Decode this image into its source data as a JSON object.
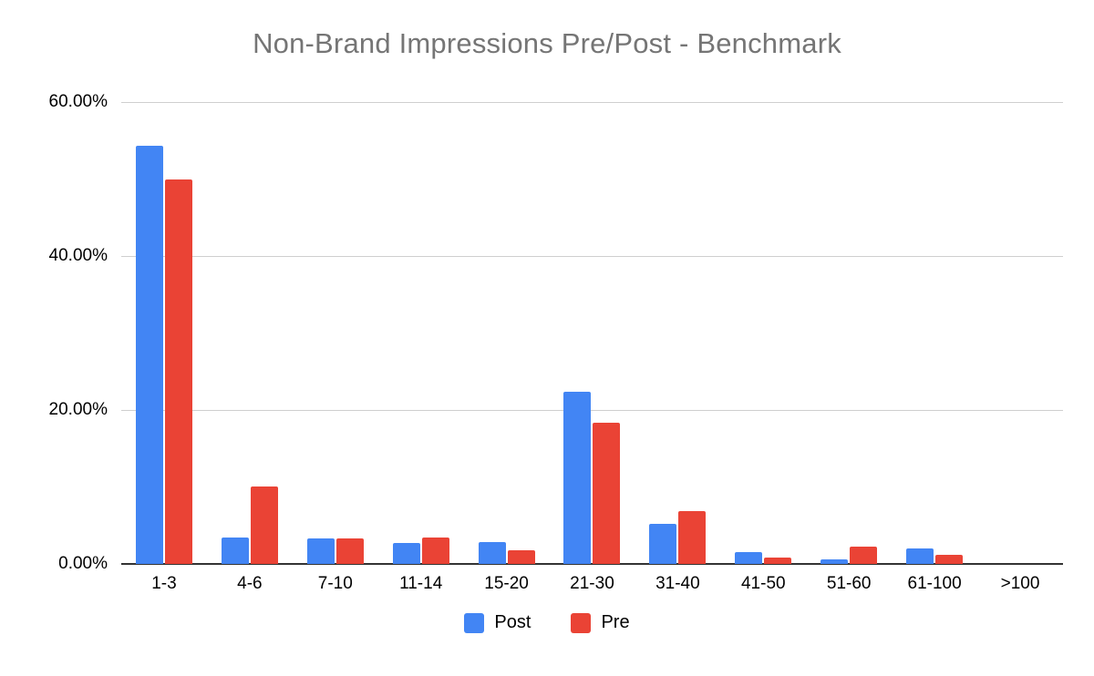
{
  "chart_data": {
    "type": "bar",
    "title": "Non-Brand Impressions Pre/Post - Benchmark",
    "xlabel": "",
    "ylabel": "",
    "categories": [
      "1-3",
      "4-6",
      "7-10",
      "11-14",
      "15-20",
      "21-30",
      "31-40",
      "41-50",
      "51-60",
      "61-100",
      ">100"
    ],
    "series": [
      {
        "name": "Post",
        "color": "#4285f4",
        "values": [
          54.3,
          3.4,
          3.3,
          2.7,
          2.8,
          22.4,
          5.2,
          1.5,
          0.6,
          2.0,
          0.0
        ]
      },
      {
        "name": "Pre",
        "color": "#ea4335",
        "values": [
          50.0,
          10.1,
          3.3,
          3.4,
          1.8,
          18.3,
          6.9,
          0.8,
          2.2,
          1.2,
          0.0
        ]
      }
    ],
    "ylim": [
      0,
      60
    ],
    "y_ticks": [
      60,
      40,
      20,
      0
    ],
    "y_tick_labels": [
      "60.00%",
      "40.00%",
      "20.00%",
      "0.00%"
    ],
    "grid": true,
    "legend_position": "bottom",
    "value_format": "percent"
  },
  "colors": {
    "post": "#4285f4",
    "pre": "#ea4335",
    "gridline": "#cfcfcf",
    "axis": "#333333",
    "title": "#757575",
    "tick_text": "#000000",
    "background": "#ffffff"
  }
}
